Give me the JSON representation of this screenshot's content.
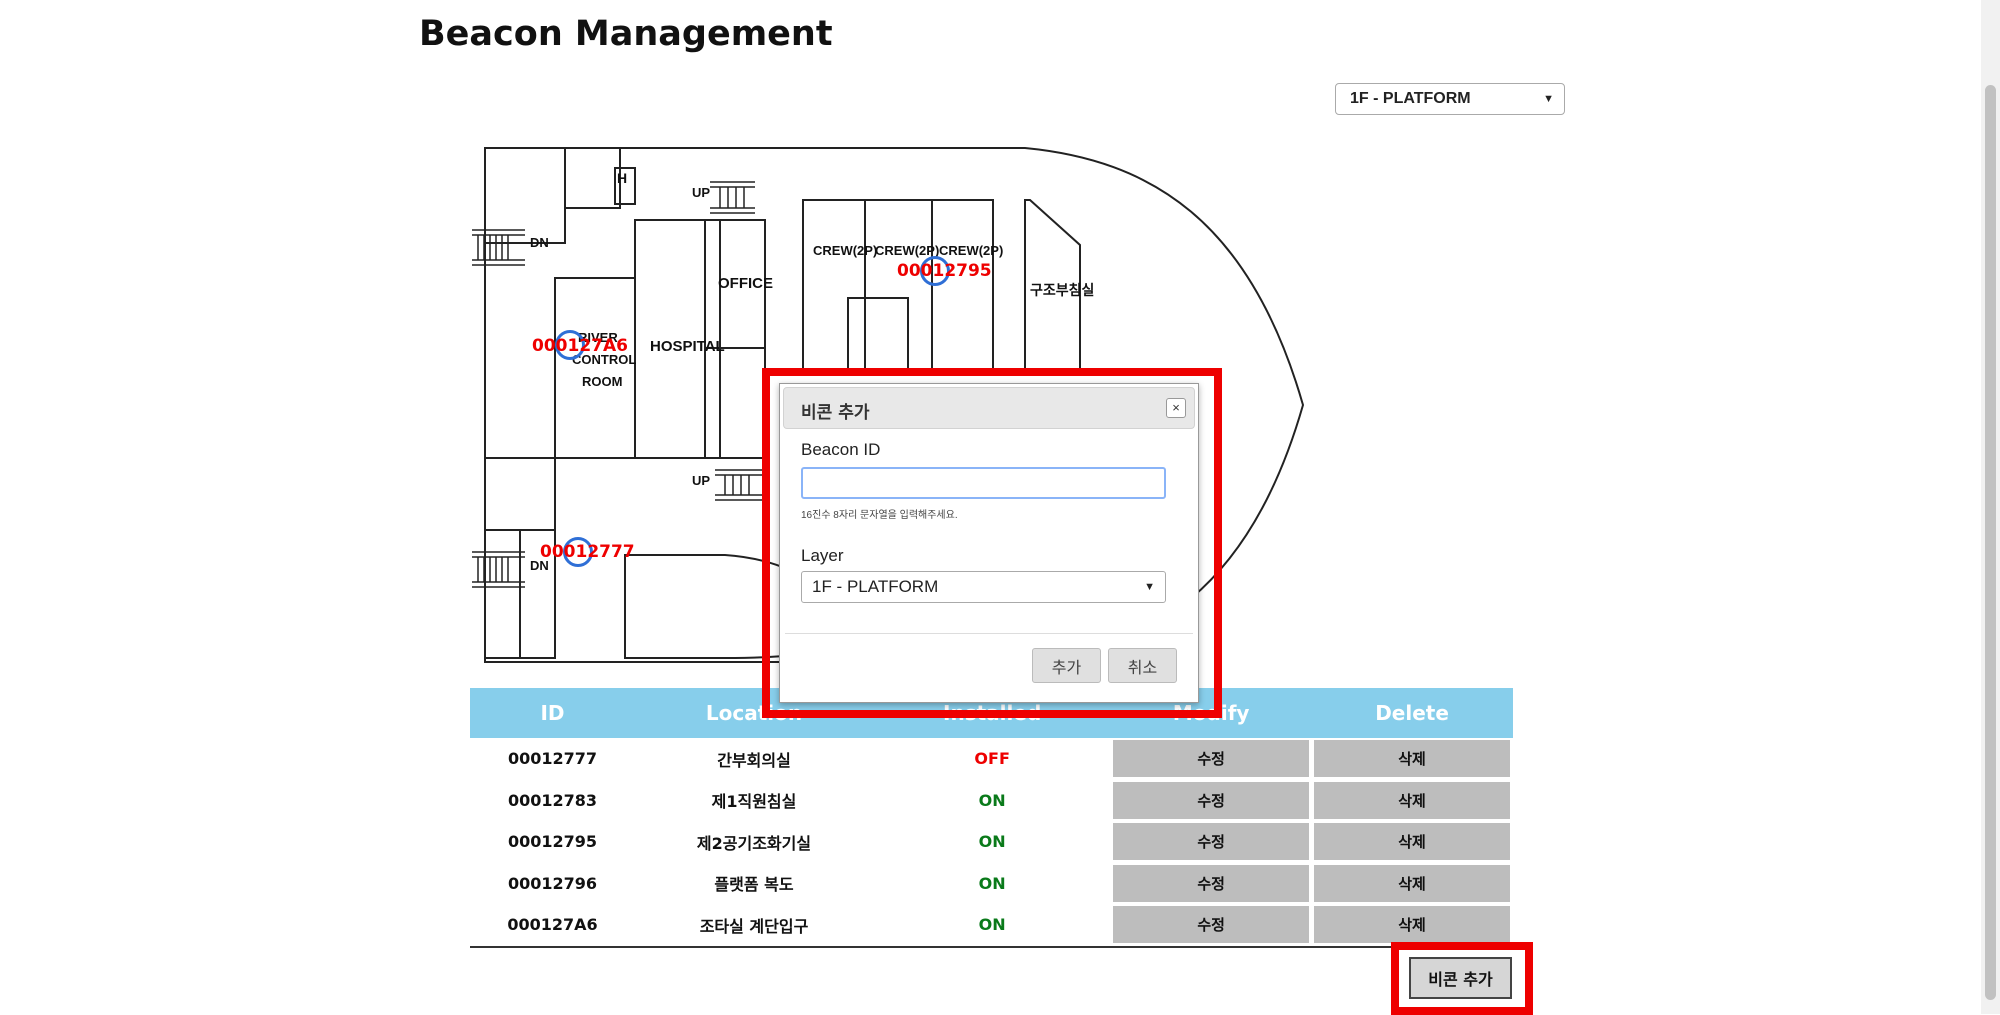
{
  "page": {
    "title": "Beacon Management"
  },
  "floor_select": {
    "value": "1F - PLATFORM"
  },
  "floorplan": {
    "room_labels": [
      "H",
      "UP",
      "DN",
      "OFFICE",
      "HOSPITAL",
      "RIVER",
      "CONTROL",
      "ROOM",
      "CREW(2P)",
      "CREW(2P)",
      "CREW(2P)",
      "구조부침실",
      "UP",
      "DN"
    ],
    "markers": [
      {
        "label": "00012795"
      },
      {
        "label": "000127A6"
      },
      {
        "label": "00012777"
      }
    ]
  },
  "table": {
    "headers": [
      "ID",
      "Location",
      "Installed",
      "Modify",
      "Delete"
    ],
    "rows": [
      {
        "id": "00012777",
        "location": "간부회의실",
        "status": "OFF",
        "modify": "수정",
        "delete": "삭제"
      },
      {
        "id": "00012783",
        "location": "제1직원침실",
        "status": "ON",
        "modify": "수정",
        "delete": "삭제"
      },
      {
        "id": "00012795",
        "location": "제2공기조화기실",
        "status": "ON",
        "modify": "수정",
        "delete": "삭제"
      },
      {
        "id": "00012796",
        "location": "플랫폼 복도",
        "status": "ON",
        "modify": "수정",
        "delete": "삭제"
      },
      {
        "id": "000127A6",
        "location": "조타실 계단입구",
        "status": "ON",
        "modify": "수정",
        "delete": "삭제"
      }
    ]
  },
  "add_button": {
    "label": "비콘 추가"
  },
  "modal": {
    "title": "비콘 추가",
    "close_icon": "×",
    "beacon_id_label": "Beacon ID",
    "beacon_id_value": "",
    "helper_text": "16진수 8자리 문자열을 입력해주세요.",
    "layer_label": "Layer",
    "layer_value": "1F - PLATFORM",
    "confirm_label": "추가",
    "cancel_label": "취소"
  },
  "colors": {
    "header_bg": "#87ceeb",
    "status_on": "#0a7a1a",
    "status_off": "#ee0000",
    "highlight": "#ee0000",
    "marker": "#2f6fd6"
  }
}
